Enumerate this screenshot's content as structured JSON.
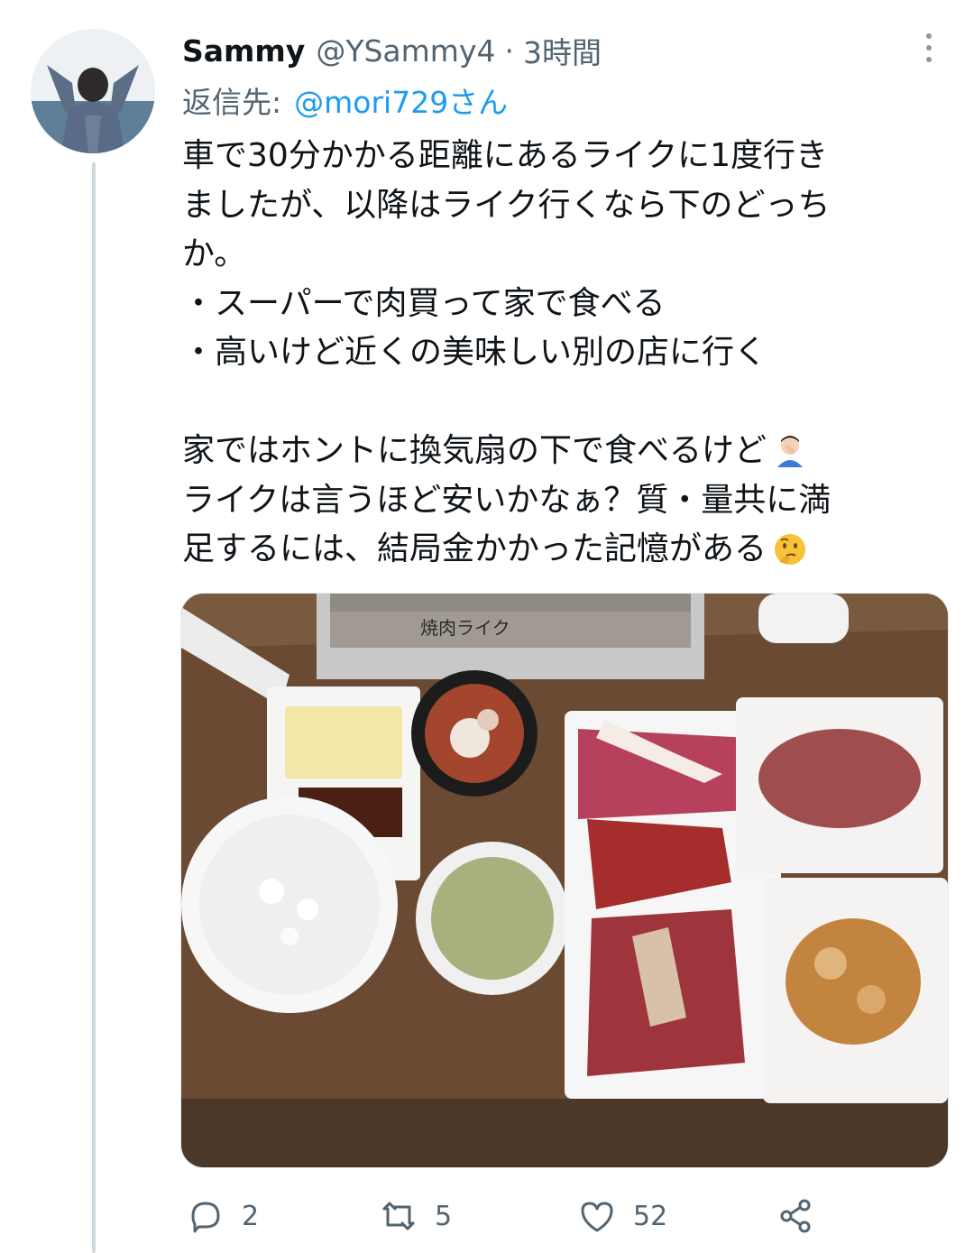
{
  "tweet": {
    "author_name": "Sammy",
    "author_handle": "@YSammy4",
    "separator": "·",
    "time": "3時間",
    "reply_label": "返信先:",
    "reply_mention": "@mori729さん",
    "lines": [
      "車で30分かかる距離にあるライクに1度行き",
      "ましたが、以降はライク行くなら下のどっち",
      "か。",
      "・スーパーで肉買って家で食べる",
      "・高いけど近くの美味しい別の店に行く",
      "",
      "家ではホントに換気扇の下で食べるけど",
      "ライクは言うほど安いかなぁ？質・量共に満",
      "足するには、結局金かかった記憶がある"
    ],
    "emoji_line_7": "facepalm-emoji",
    "emoji_line_9": "thinking-face-emoji",
    "photo": {
      "grill_sign": "焼肉ライク"
    }
  },
  "actions": {
    "reply_count": "2",
    "retweet_count": "5",
    "like_count": "52",
    "reply_icon": "reply-icon",
    "retweet_icon": "retweet-icon",
    "like_icon": "heart-icon",
    "share_icon": "share-icon"
  },
  "colors": {
    "link": "#1d9bf0",
    "secondary_text": "#536471",
    "primary_text": "#0f1419",
    "thread_line": "#cfd9de"
  }
}
